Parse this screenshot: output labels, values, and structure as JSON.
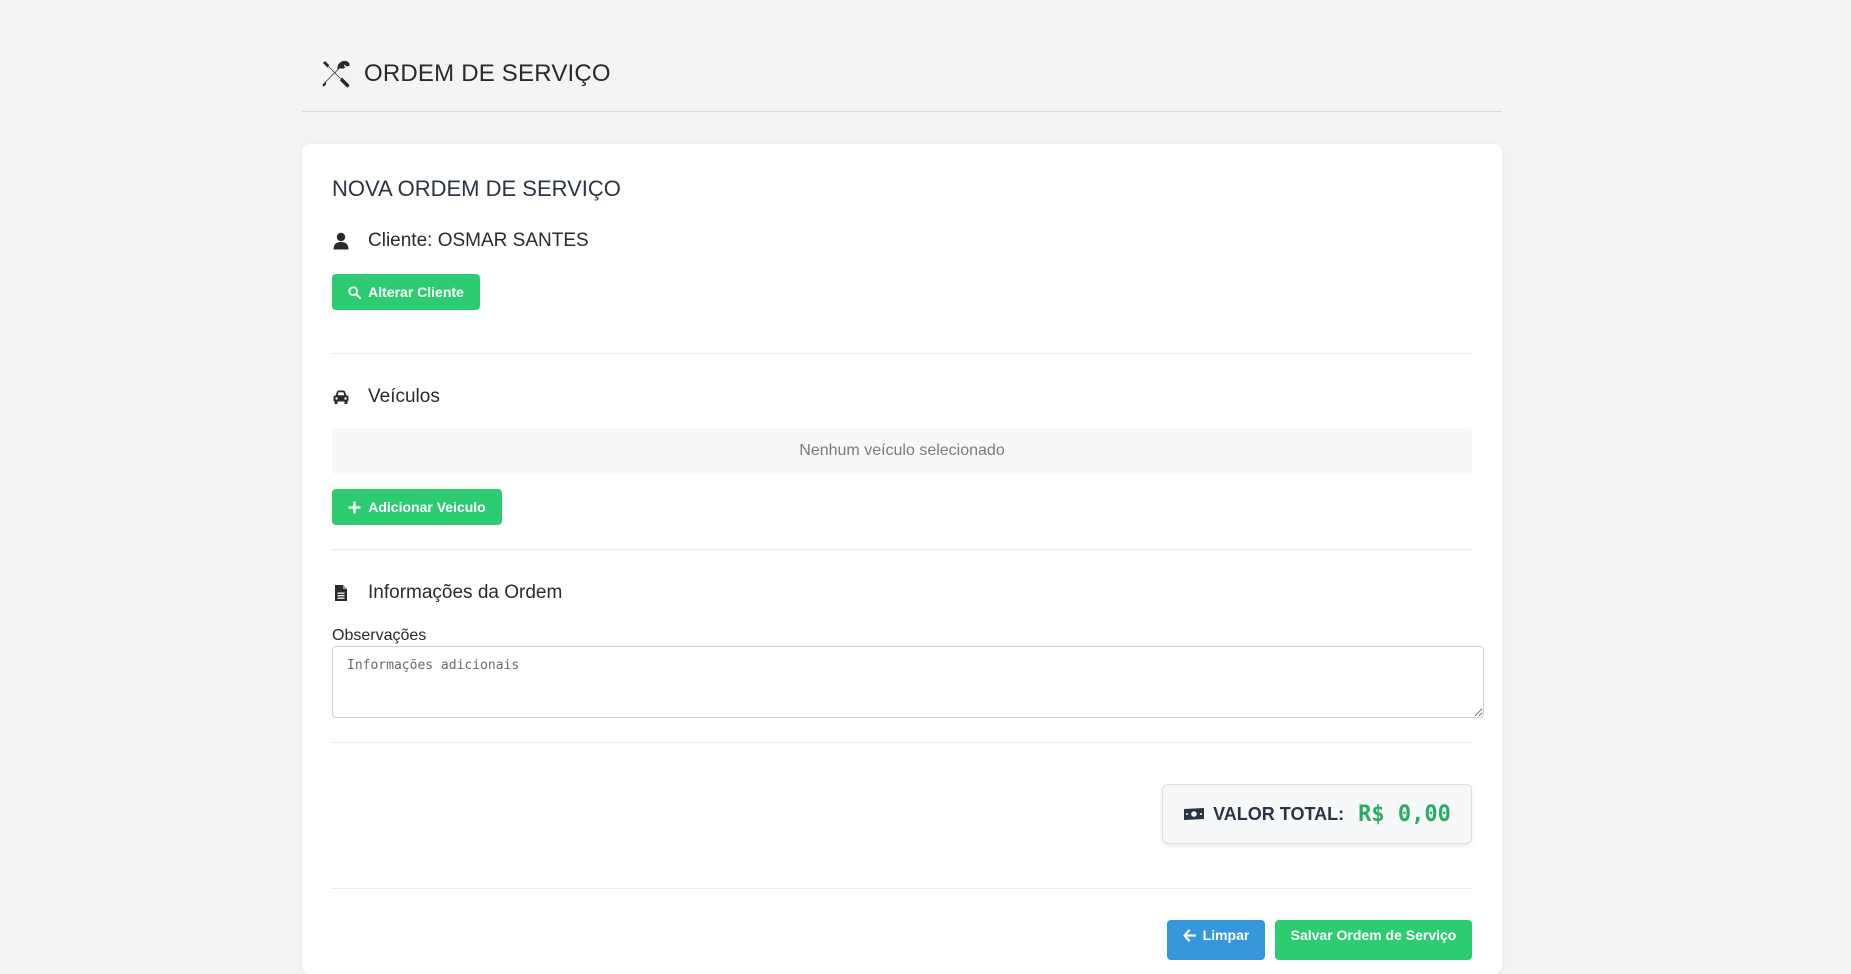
{
  "header": {
    "title": "ORDEM DE SERVIÇO",
    "icon": "tools-icon"
  },
  "form": {
    "title": "NOVA ORDEM DE SERVIÇO",
    "client": {
      "label": "Cliente: OSMAR SANTES",
      "icon": "user-icon",
      "change_button": "Alterar Cliente"
    },
    "vehicles": {
      "title": "Veículos",
      "icon": "car-icon",
      "empty_text": "Nenhum veículo selecionado",
      "add_button": "Adicionar Veiculo"
    },
    "info": {
      "title": "Informações da Ordem",
      "icon": "document-icon",
      "observations_label": "Observações",
      "observations_value": "",
      "observations_placeholder": "Informações adicionais"
    },
    "total": {
      "label": "VALOR TOTAL:",
      "value": "R$ 0,00",
      "icon": "money-icon"
    },
    "actions": {
      "clear_button": "Limpar",
      "save_button": "Salvar Ordem de Serviço"
    }
  },
  "colors": {
    "background": "#f4f4f4",
    "card": "#ffffff",
    "primary_green": "#2ecc71",
    "total_green": "#27ae60",
    "blue": "#3498db",
    "heading": "#2b3442"
  }
}
